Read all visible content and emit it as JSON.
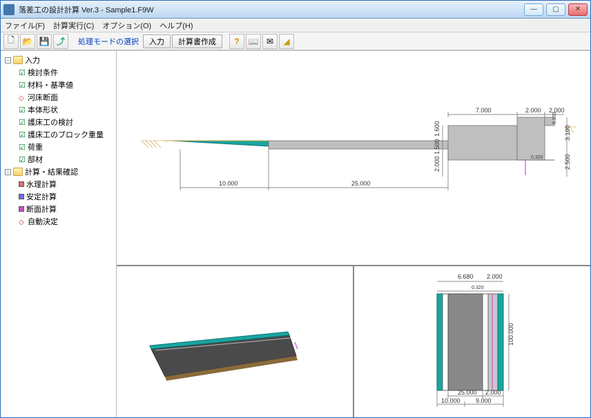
{
  "window": {
    "title": "落差工の設計計算 Ver.3 - Sample1.F9W"
  },
  "menu": {
    "file": "ファイル(F)",
    "calc": "計算実行(C)",
    "option": "オプション(O)",
    "help": "ヘルプ(H)"
  },
  "toolbar": {
    "mode_label": "処理モードの選択",
    "btn_input": "入力",
    "btn_report": "計算書作成"
  },
  "tree": {
    "root1": "入力",
    "r1_items": [
      {
        "icon": "green",
        "label": "検討条件"
      },
      {
        "icon": "green",
        "label": "材料・基準値"
      },
      {
        "icon": "red",
        "label": "河床断面"
      },
      {
        "icon": "green",
        "label": "本体形状"
      },
      {
        "icon": "green",
        "label": "護床工の検討"
      },
      {
        "icon": "green",
        "label": "護床工のブロック重量"
      },
      {
        "icon": "green",
        "label": "荷重"
      },
      {
        "icon": "green",
        "label": "部材"
      }
    ],
    "root2": "計算・結果確認",
    "r2_items": [
      {
        "color": "#e07070",
        "label": "水理計算"
      },
      {
        "color": "#7070e0",
        "label": "安定計算"
      },
      {
        "color": "#d050c0",
        "label": "断面計算"
      },
      {
        "icon": "red",
        "label": "自動決定"
      }
    ]
  },
  "dims_top": {
    "d10": "10.000",
    "d25": "25.000",
    "d7": "7.000",
    "d2a": "2.000",
    "d2b": "2.000",
    "d2c": "2.000",
    "d1_6": "1.600",
    "d1_5": "1.500",
    "d0_3": "0.320",
    "d3_1": "3.100",
    "d2_5": "2.500",
    "d0_1": "0.100"
  },
  "dims_br": {
    "d6_68": "6.680",
    "d2a": "2.000",
    "d0_32": "0.320",
    "d100": "100.000",
    "d25": "25.000",
    "d2b": "2.000",
    "d10": "10.000",
    "d9": "9.000"
  }
}
